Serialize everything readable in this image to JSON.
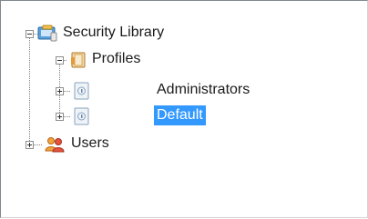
{
  "tree": {
    "root": {
      "label": "Security Library",
      "icon": "library-icon",
      "expanded": true
    },
    "profiles": {
      "label": "Profiles",
      "icon": "folder-icon",
      "expanded": true
    },
    "administrators": {
      "label": "Administrators",
      "icon": "profile-document-icon",
      "expanded": false
    },
    "default": {
      "label": "Default",
      "icon": "profile-document-icon",
      "expanded": false,
      "selected": true
    },
    "users": {
      "label": "Users",
      "icon": "users-icon",
      "expanded": false
    }
  },
  "colors": {
    "selection_bg": "#3399ff",
    "selection_text": "#ffffff",
    "connector": "#808080"
  }
}
